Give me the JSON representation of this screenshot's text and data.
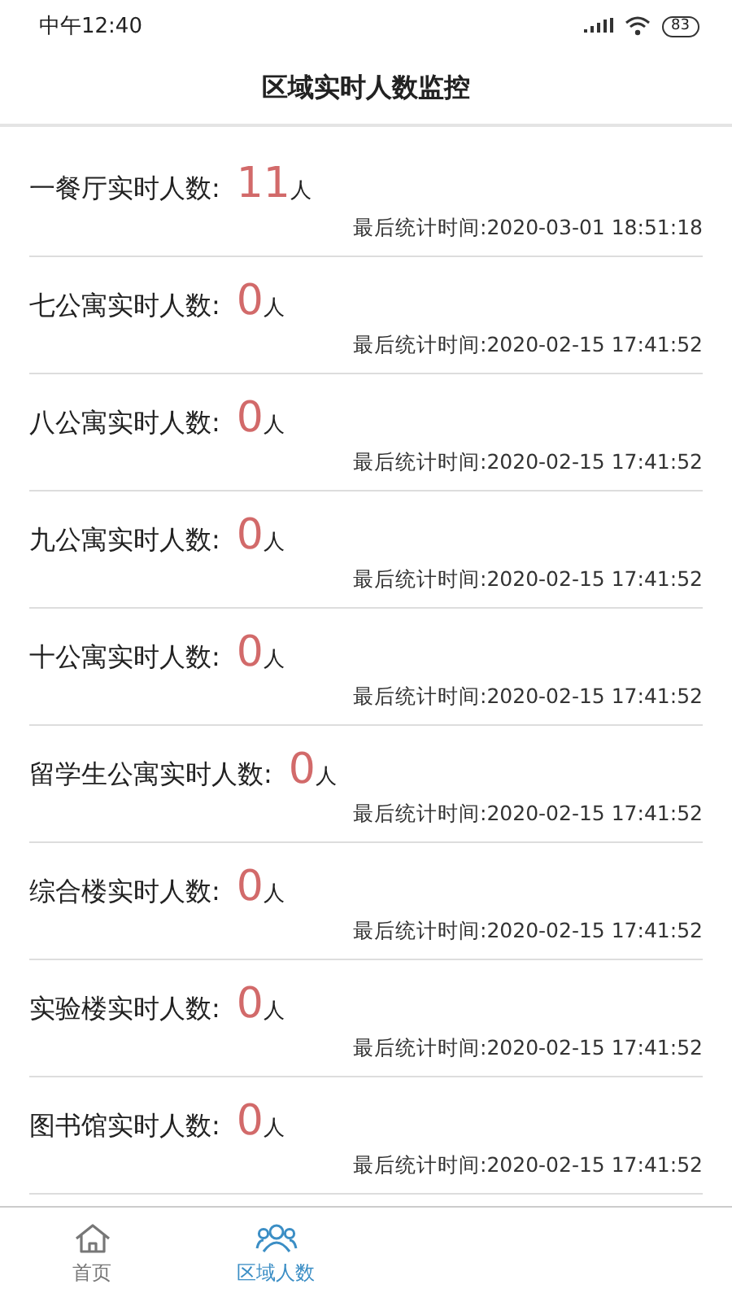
{
  "status_bar": {
    "time": "中午12:40",
    "battery": "83"
  },
  "title": "区域实时人数监控",
  "areas": [
    {
      "label": "一餐厅实时人数:",
      "count": "11",
      "unit": "人",
      "updated": "最后统计时间:2020-03-01 18:51:18"
    },
    {
      "label": "七公寓实时人数:",
      "count": "0",
      "unit": "人",
      "updated": "最后统计时间:2020-02-15 17:41:52"
    },
    {
      "label": "八公寓实时人数:",
      "count": "0",
      "unit": "人",
      "updated": "最后统计时间:2020-02-15 17:41:52"
    },
    {
      "label": "九公寓实时人数:",
      "count": "0",
      "unit": "人",
      "updated": "最后统计时间:2020-02-15 17:41:52"
    },
    {
      "label": "十公寓实时人数:",
      "count": "0",
      "unit": "人",
      "updated": "最后统计时间:2020-02-15 17:41:52"
    },
    {
      "label": "留学生公寓实时人数:",
      "count": "0",
      "unit": "人",
      "updated": "最后统计时间:2020-02-15 17:41:52"
    },
    {
      "label": "综合楼实时人数:",
      "count": "0",
      "unit": "人",
      "updated": "最后统计时间:2020-02-15 17:41:52"
    },
    {
      "label": "实验楼实时人数:",
      "count": "0",
      "unit": "人",
      "updated": "最后统计时间:2020-02-15 17:41:52"
    },
    {
      "label": "图书馆实时人数:",
      "count": "0",
      "unit": "人",
      "updated": "最后统计时间:2020-02-15 17:41:52"
    }
  ],
  "tabs": [
    {
      "label": "首页",
      "kind": "home",
      "selected": false
    },
    {
      "label": "区域人数",
      "kind": "people",
      "selected": true
    }
  ]
}
